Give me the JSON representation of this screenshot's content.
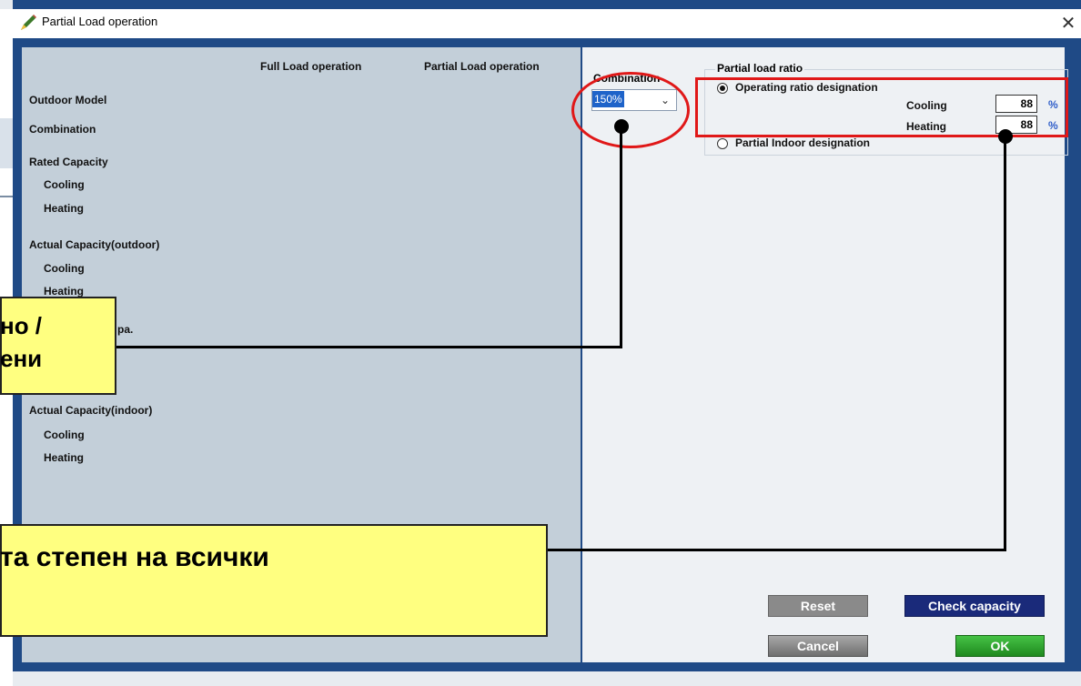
{
  "window": {
    "title": "Partial Load operation",
    "close_glyph": "✕"
  },
  "columns": {
    "full_load": "Full Load operation",
    "partial_load": "Partial Load operation"
  },
  "rows": {
    "outdoor_model": "Outdoor Model",
    "combination": "Combination",
    "rated_capacity": "Rated Capacity",
    "rated_cooling": "Cooling",
    "rated_heating": "Heating",
    "actual_outdoor": "Actual Capacity(outdoor)",
    "outdoor_cooling": "Cooling",
    "outdoor_heating": "Heating",
    "partial_label": "pa.",
    "actual_indoor": "Actual Capacity(indoor)",
    "indoor_cooling": "Cooling",
    "indoor_heating": "Heating"
  },
  "combination": {
    "label": "Combination",
    "selected": "150%"
  },
  "partial_load_ratio": {
    "title": "Partial load ratio",
    "operating_ratio_label": "Operating ratio designation",
    "operating_ratio_selected": true,
    "cooling_label": "Cooling",
    "cooling_value": "88",
    "heating_label": "Heating",
    "heating_value": "88",
    "unit": "%",
    "partial_indoor_label": "Partial Indoor designation",
    "partial_indoor_selected": false
  },
  "buttons": {
    "reset": "Reset",
    "check_capacity": "Check capacity",
    "cancel": "Cancel",
    "ok": "OK"
  },
  "annotations": {
    "callout1": "но /\nени",
    "callout2": "та степен на всички"
  },
  "colors": {
    "frame": "#1f4a86",
    "left_panel": "#c3cfd9",
    "annotation_red": "#e01818",
    "callout_yellow": "#ffff80",
    "check_button": "#1a2a7a",
    "ok_button": "#2aa02a"
  }
}
